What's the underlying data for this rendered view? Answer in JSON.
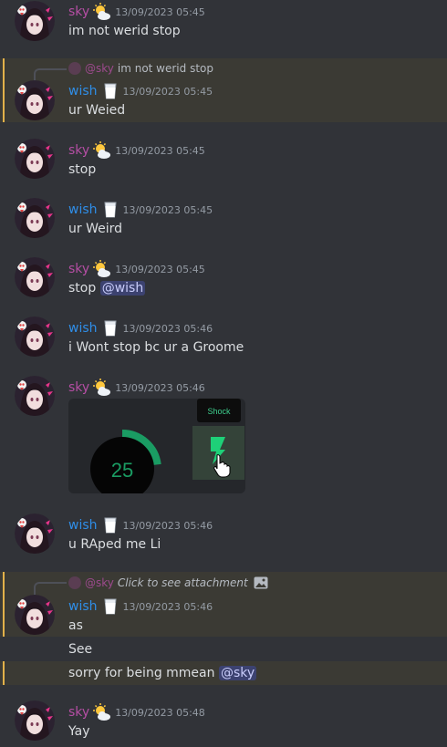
{
  "messages": [
    {
      "author": "sky",
      "timestamp": "13/09/2023 05:45",
      "text": "im not werid stop"
    },
    {
      "reply_to": {
        "author": "@sky",
        "text": "im not werid stop"
      },
      "author": "wish",
      "timestamp": "13/09/2023 05:45",
      "text": "ur Weied"
    },
    {
      "author": "sky",
      "timestamp": "13/09/2023 05:45",
      "text": "stop"
    },
    {
      "author": "wish",
      "timestamp": "13/09/2023 05:45",
      "text": "ur Weird"
    },
    {
      "author": "sky",
      "timestamp": "13/09/2023 05:45",
      "text": "stop",
      "mention": "@wish"
    },
    {
      "author": "wish",
      "timestamp": "13/09/2023 05:46",
      "text": "i Wont stop bc ur a Groome"
    },
    {
      "author": "sky",
      "timestamp": "13/09/2023 05:46",
      "embed": {
        "gauge_value": "25",
        "gauge_fraction": 0.42,
        "tooltip": "Shock"
      }
    },
    {
      "author": "wish",
      "timestamp": "13/09/2023 05:46",
      "text": "u RAped me Li"
    },
    {
      "reply_to": {
        "author": "@sky",
        "text": "Click to see attachment"
      },
      "author": "wish",
      "timestamp": "13/09/2023 05:46",
      "text": "as"
    },
    {
      "text": "See"
    },
    {
      "text": "sorry for being mmean",
      "mention": "@sky"
    },
    {
      "author": "sky",
      "timestamp": "13/09/2023 05:48",
      "text": "Yay"
    }
  ],
  "colors": {
    "sky": "#b54ea4",
    "wish": "#2f8ee8",
    "background": "#313338",
    "highlight": "#e2b14a",
    "gauge": "#1a9c63"
  },
  "icons": {
    "sky_emoji": "sun-behind-cloud-icon",
    "wish_emoji": "glass-of-milk-icon",
    "attachment": "image-icon",
    "cursor": "hand-pointer-icon",
    "bolt": "lightning-bolt-icon"
  }
}
